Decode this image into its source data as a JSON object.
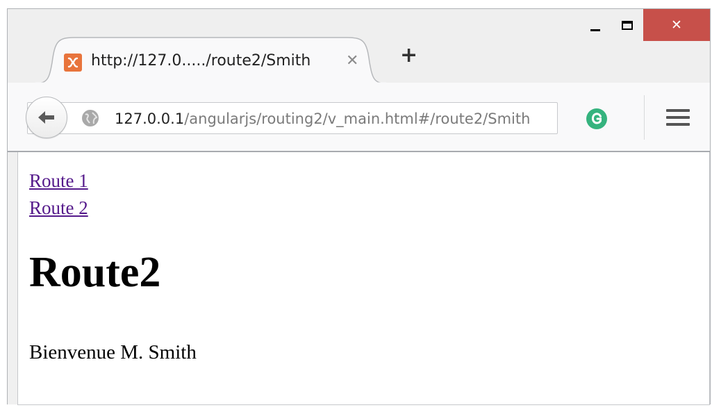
{
  "window": {
    "controls": {
      "minimize_icon": "minimize-icon",
      "maximize_icon": "maximize-icon",
      "close_symbol": "✕",
      "close_color": "#c7504a"
    }
  },
  "tabs": [
    {
      "title": "http://127.0...../route2/Smith",
      "close_symbol": "✕",
      "favicon": "xampp-icon",
      "favicon_color": "#e8743c"
    }
  ],
  "new_tab_symbol": "+",
  "navbar": {
    "back_icon": "back-arrow-icon",
    "url_host": "127.0.0.1",
    "url_path": "/angularjs/routing2/v_main.html#/route2/Smith",
    "site_icon": "globe-icon",
    "extension_icon": "grammarly-icon",
    "extension_color": "#35b37e",
    "menu_icon": "hamburger-menu-icon"
  },
  "page": {
    "links": [
      {
        "label": "Route 1"
      },
      {
        "label": "Route 2"
      }
    ],
    "heading": "Route2",
    "welcome_text": "Bienvenue M. Smith",
    "link_color": "#551a8b"
  }
}
